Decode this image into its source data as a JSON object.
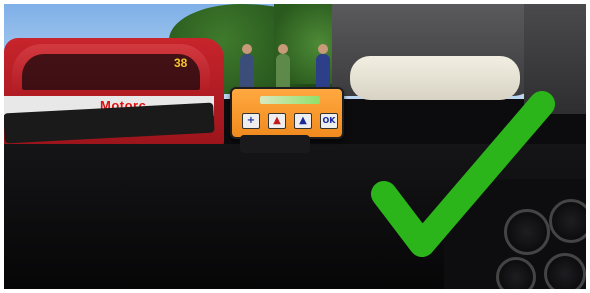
{
  "scene": {
    "car_sponsor_text": "Motorc",
    "car_number": "38",
    "device_buttons": [
      {
        "glyph": "+",
        "color": "#1a2a9a"
      },
      {
        "glyph": "▲",
        "color": "#c21a1a"
      },
      {
        "glyph": "▲",
        "color": "#1a2a9a"
      },
      {
        "glyph": "OK",
        "color": "#1a2a9a"
      }
    ]
  },
  "overlay": {
    "icon": "checkmark-icon",
    "color": "#2bb51a"
  }
}
